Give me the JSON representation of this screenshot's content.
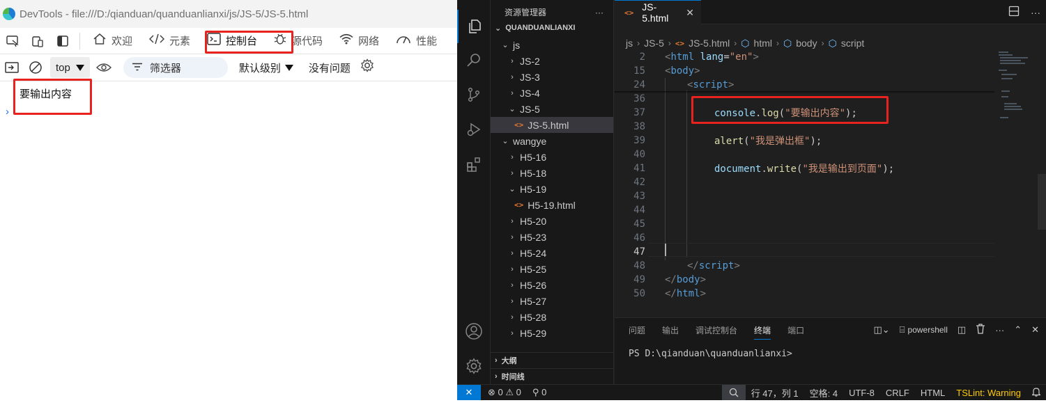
{
  "devtools": {
    "title": "DevTools - file:///D:/qianduan/quanduanlianxi/js/JS-5/JS-5.html",
    "tabs": [
      {
        "icon": "home-icon",
        "label": "欢迎"
      },
      {
        "icon": "code-icon",
        "label": "元素"
      },
      {
        "icon": "console-icon",
        "label": "控制台"
      },
      {
        "icon": "bug-icon",
        "label": "源代码"
      },
      {
        "icon": "wifi-icon",
        "label": "网络"
      },
      {
        "icon": "performance-icon",
        "label": "性能"
      }
    ],
    "active_tab": "控制台",
    "context": "top",
    "filter_placeholder": "筛选器",
    "level": "默认级别",
    "issues": "没有问题",
    "log_output": "要输出内容",
    "prompt": "›",
    "highlight_color": "#e8231f"
  },
  "vscode": {
    "explorer_title": "资源管理器",
    "explorer_more": "···",
    "workspace": "QUANDUANLIANXI",
    "tree": [
      {
        "label": "js",
        "chev": "⌄"
      },
      {
        "label": "JS-2",
        "chev": "›"
      },
      {
        "label": "JS-3",
        "chev": "›"
      },
      {
        "label": "JS-4",
        "chev": "›"
      },
      {
        "label": "JS-5",
        "chev": "⌄"
      },
      {
        "label": "JS-5.html",
        "chev": ""
      },
      {
        "label": "wangye",
        "chev": "⌄"
      },
      {
        "label": "H5-16",
        "chev": "›"
      },
      {
        "label": "H5-18",
        "chev": "›"
      },
      {
        "label": "H5-19",
        "chev": "⌄"
      },
      {
        "label": "H5-19.html",
        "chev": ""
      },
      {
        "label": "H5-20",
        "chev": "›"
      },
      {
        "label": "H5-23",
        "chev": "›"
      },
      {
        "label": "H5-24",
        "chev": "›"
      },
      {
        "label": "H5-25",
        "chev": "›"
      },
      {
        "label": "H5-26",
        "chev": "›"
      },
      {
        "label": "H5-27",
        "chev": "›"
      },
      {
        "label": "H5-28",
        "chev": "›"
      },
      {
        "label": "H5-29",
        "chev": "›"
      }
    ],
    "outline": "大纲",
    "timeline": "时间线",
    "tab_label": "JS-5.html",
    "file_icon_glyph": "<>",
    "breadcrumb": [
      "js",
      "JS-5",
      "JS-5.html",
      "html",
      "body",
      "script"
    ],
    "code": {
      "ln": [
        "2",
        "15",
        "24",
        "36",
        "37",
        "38",
        "39",
        "40",
        "41",
        "42",
        "43",
        "44",
        "45",
        "46",
        "47",
        "48",
        "49",
        "50"
      ],
      "html_open_attr": "lang",
      "html_open_value": "\"en\"",
      "log_obj": "console",
      "log_fn": "log",
      "log_arg": "\"要输出内容\"",
      "alert_fn": "alert",
      "alert_arg": "\"我是弹出框\"",
      "doc_obj": "document",
      "doc_fn": "write",
      "doc_arg": "\"我是输出到页面\""
    },
    "panel_tabs": [
      "问题",
      "输出",
      "调试控制台",
      "终端",
      "端口"
    ],
    "active_panel": "终端",
    "terminal_name": "powershell",
    "terminal_prompt": "PS D:\\qianduan\\quanduanlianxi>",
    "status": {
      "errors": "0",
      "warnings": "0",
      "ports": "0",
      "position": "行 47，列 1",
      "spaces": "空格: 4",
      "encoding": "UTF-8",
      "eol": "CRLF",
      "language": "HTML",
      "tslint": "TSLint: Warning"
    },
    "accent": "#0078d4"
  }
}
